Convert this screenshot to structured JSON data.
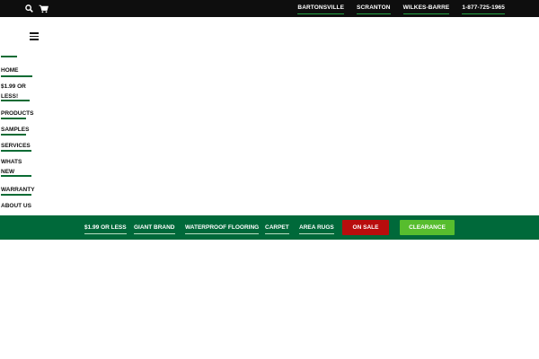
{
  "topbar": {
    "icons": [
      "search-icon",
      "cart-icon"
    ],
    "links": [
      "BARTONSVILLE",
      "SCRANTON",
      "WILKES-BARRE",
      "1-877-725-1965"
    ],
    "accent_color": "#23a142"
  },
  "menu": {
    "icon": "hamburger-icon",
    "items": [
      {
        "lines": [
          "HOME"
        ]
      },
      {
        "lines": [
          "$1.99 OR",
          "LESS!"
        ]
      },
      {
        "lines": [
          "PRODUCTS"
        ]
      },
      {
        "lines": [
          "SAMPLES"
        ]
      },
      {
        "lines": [
          "SERVICES"
        ]
      },
      {
        "lines": [
          "WHATS",
          "NEW"
        ]
      },
      {
        "lines": [
          "WARRANTY"
        ]
      },
      {
        "lines": [
          "ABOUT US"
        ]
      }
    ],
    "accent_color": "#0a6b34"
  },
  "category_bar": {
    "items": [
      "$1.99 OR LESS",
      "GIANT BRAND",
      "WATERPROOF FLOORING",
      "CARPET",
      "AREA RUGS"
    ],
    "on_sale_label": "ON SALE",
    "clearance_label": "CLEARANCE",
    "bar_color": "#00693a",
    "on_sale_color": "#b80d0d",
    "clearance_color": "#57bd2e"
  }
}
